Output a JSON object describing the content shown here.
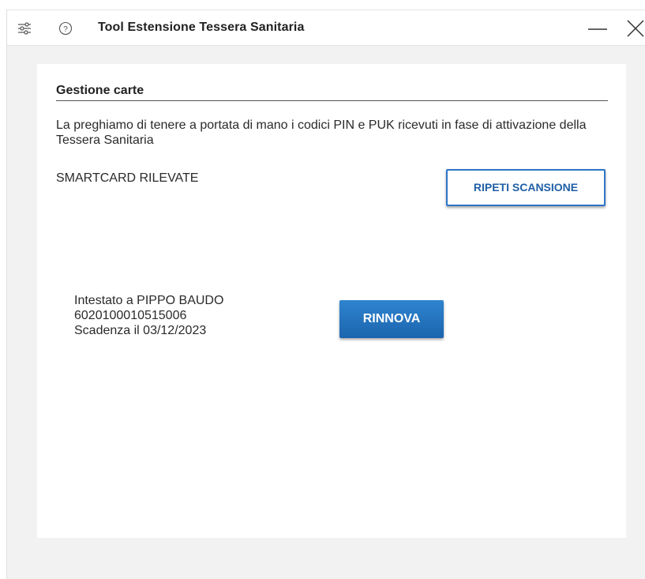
{
  "window": {
    "title": "Tool Estensione Tessera Sanitaria",
    "icons": {
      "settings": "settings-sliders-icon",
      "help": "help-circle-icon",
      "minimize": "minimize-icon",
      "close": "close-icon"
    }
  },
  "card_management": {
    "section_title": "Gestione carte",
    "intro_text": "La preghiamo di tenere a portata di mano i codici PIN e PUK ricevuti in fase di attivazione della Tessera Sanitaria",
    "detected_label": "SMARTCARD RILEVATE",
    "rescan_label": "RIPETI SCANSIONE"
  },
  "cards": [
    {
      "holder": "Intestato a PIPPO BAUDO",
      "number": "6020100010515006",
      "expiry": "Scadenza il 03/12/2023",
      "renew_label": "RINNOVA"
    }
  ],
  "colors": {
    "accent": "#1f6fbf",
    "window_background": "#f2f2f2"
  }
}
